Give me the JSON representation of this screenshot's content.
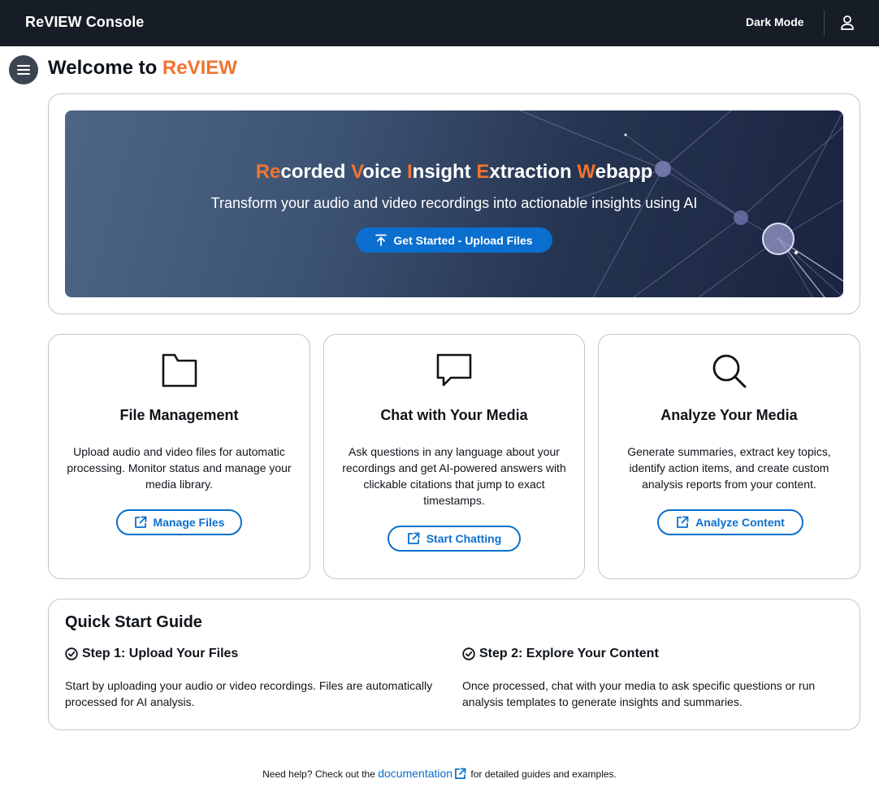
{
  "topnav": {
    "brand": "ReVIEW Console",
    "dark_mode_label": "Dark Mode",
    "user_icon": "user-profile-icon"
  },
  "header": {
    "menu_icon": "hamburger-menu-icon",
    "title_prefix": "Welcome to",
    "title_accent": "ReVIEW"
  },
  "hero": {
    "title_parts": [
      {
        "accent": "Re",
        "rest": "corded"
      },
      {
        "accent": "V",
        "rest": "oice"
      },
      {
        "accent": "I",
        "rest": "nsight"
      },
      {
        "accent": "E",
        "rest": "xtraction"
      },
      {
        "accent": "W",
        "rest": "ebapp"
      }
    ],
    "subtitle": "Transform your audio and video recordings into actionable insights using AI",
    "button_label": "Get Started - Upload Files",
    "button_icon": "upload-icon"
  },
  "features": [
    {
      "icon": "folder-icon",
      "title": "File Management",
      "description": "Upload audio and video files for automatic processing. Monitor status and manage your media library.",
      "button_label": "Manage Files",
      "button_icon": "external-link-icon"
    },
    {
      "icon": "chat-bubble-icon",
      "title": "Chat with Your Media",
      "description": "Ask questions in any language about your recordings and get AI-powered answers with clickable citations that jump to exact timestamps.",
      "button_label": "Start Chatting",
      "button_icon": "external-link-icon"
    },
    {
      "icon": "search-icon",
      "title": "Analyze Your Media",
      "description": "Generate summaries, extract key topics, identify action items, and create custom analysis reports from your content.",
      "button_label": "Analyze Content",
      "button_icon": "external-link-icon"
    }
  ],
  "quick_start": {
    "title": "Quick Start Guide",
    "steps": [
      {
        "icon": "check-circle-icon",
        "title": "Step 1: Upload Your Files",
        "description": "Start by uploading your audio or video recordings. Files are automatically processed for AI analysis."
      },
      {
        "icon": "check-circle-icon",
        "title": "Step 2: Explore Your Content",
        "description": "Once processed, chat with your media to ask specific questions or run analysis templates to generate insights and summaries."
      }
    ]
  },
  "footer": {
    "prefix": "Need help? Check out the",
    "link_text": "documentation",
    "suffix": "for detailed guides and examples."
  },
  "colors": {
    "nav_bg": "#161d26",
    "accent_orange": "#f2742e",
    "primary_blue": "#0a6fcf",
    "border": "#c6c6cd"
  }
}
